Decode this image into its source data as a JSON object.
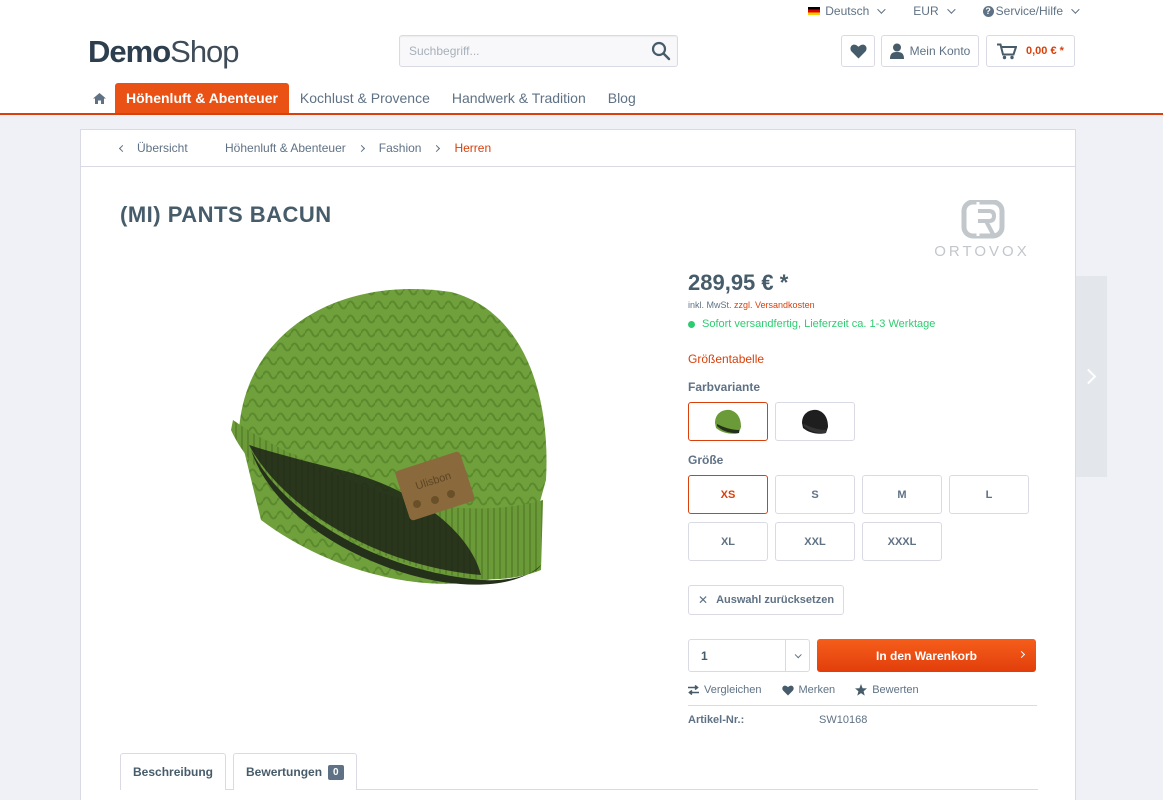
{
  "topbar": {
    "language": "Deutsch",
    "currency": "EUR",
    "service": "Service/Hilfe"
  },
  "logo": {
    "part1": "Demo",
    "part2": "Shop"
  },
  "search": {
    "placeholder": "Suchbegriff..."
  },
  "header_buttons": {
    "account_label": "Mein Konto",
    "cart_amount": "0,00 € *"
  },
  "nav": {
    "items": [
      {
        "label": "Höhenluft & Abenteuer",
        "active": true
      },
      {
        "label": "Kochlust & Provence",
        "active": false
      },
      {
        "label": "Handwerk & Tradition",
        "active": false
      },
      {
        "label": "Blog",
        "active": false
      }
    ]
  },
  "breadcrumb": {
    "back_label": "Übersicht",
    "path": [
      "Höhenluft & Abenteuer",
      "Fashion",
      "Herren"
    ]
  },
  "product": {
    "title": "(MI) PANTS BACUN",
    "brand": "ORTOVOX",
    "price": "289,95 € *",
    "tax_prefix": "inkl. MwSt.",
    "tax_link": "zzgl. Versandkosten",
    "delivery": "Sofort versandfertig, Lieferzeit ca. 1-3 Werktage",
    "size_table_link": "Größentabelle",
    "color_label": "Farbvariante",
    "colors": [
      {
        "name": "green-beanie",
        "color": "#6b9a3a",
        "selected": true
      },
      {
        "name": "black-beanie",
        "color": "#1e1e1e",
        "selected": false
      }
    ],
    "size_label": "Größe",
    "sizes": [
      "XS",
      "S",
      "M",
      "L",
      "XL",
      "XXL",
      "XXXL"
    ],
    "selected_size": "XS",
    "reset_label": "Auswahl zurücksetzen",
    "quantity": "1",
    "add_to_cart": "In den Warenkorb",
    "actions": {
      "compare": "Vergleichen",
      "remember": "Merken",
      "review": "Bewerten"
    },
    "article_label": "Artikel-Nr.:",
    "article_number": "SW10168"
  },
  "tabs": {
    "description": "Beschreibung",
    "reviews": "Bewertungen",
    "reviews_count": "0"
  },
  "colors": {
    "accent": "#d9400b",
    "button": "#ea5114",
    "text": "#5f7285",
    "success": "#2ecc71"
  }
}
